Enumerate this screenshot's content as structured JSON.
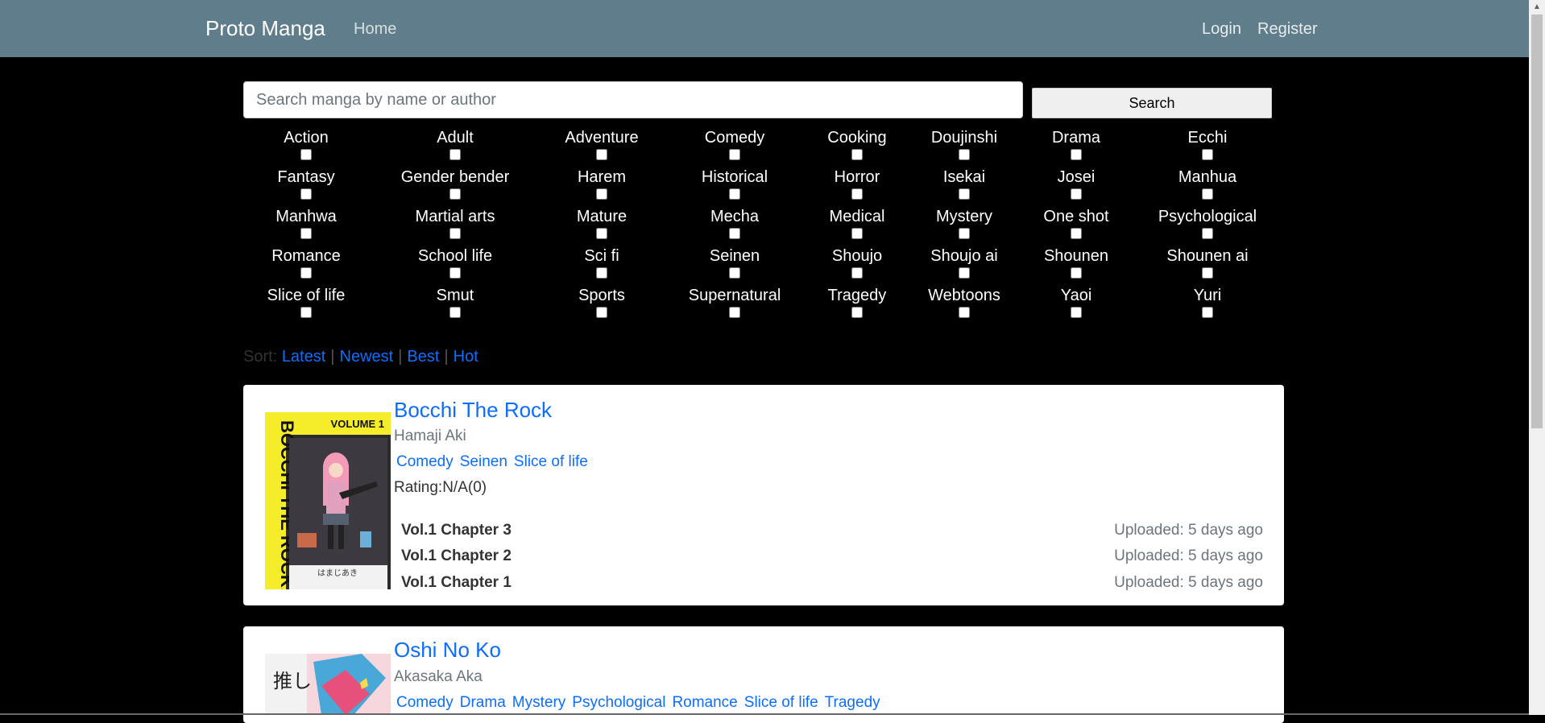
{
  "navbar": {
    "brand": "Proto Manga",
    "home": "Home",
    "login": "Login",
    "register": "Register",
    "background": "#607d8b"
  },
  "search": {
    "placeholder": "Search manga by name or author",
    "value": "",
    "button_label": "Search"
  },
  "genres": [
    [
      "Action",
      "Adult",
      "Adventure",
      "Comedy",
      "Cooking",
      "Doujinshi",
      "Drama",
      "Ecchi"
    ],
    [
      "Fantasy",
      "Gender bender",
      "Harem",
      "Historical",
      "Horror",
      "Isekai",
      "Josei",
      "Manhua"
    ],
    [
      "Manhwa",
      "Martial arts",
      "Mature",
      "Mecha",
      "Medical",
      "Mystery",
      "One shot",
      "Psychological"
    ],
    [
      "Romance",
      "School life",
      "Sci fi",
      "Seinen",
      "Shoujo",
      "Shoujo ai",
      "Shounen",
      "Shounen ai"
    ],
    [
      "Slice of life",
      "Smut",
      "Sports",
      "Supernatural",
      "Tragedy",
      "Webtoons",
      "Yaoi",
      "Yuri"
    ]
  ],
  "sort": {
    "label": "Sort:",
    "options": [
      "Latest",
      "Newest",
      "Best",
      "Hot"
    ],
    "separator": "|"
  },
  "manga": [
    {
      "title": "Bocchi The Rock",
      "author": "Hamaji Aki",
      "tags": [
        "Comedy",
        "Seinen",
        "Slice of life"
      ],
      "rating": "Rating:N/A(0)",
      "cover_text": "BOCCHI THE ROCK!",
      "cover_volume": "VOLUME 1",
      "cover_subtext": "はまじあき",
      "chapters": [
        {
          "name": "Vol.1 Chapter 3",
          "uploaded": "Uploaded: 5 days ago"
        },
        {
          "name": "Vol.1 Chapter 2",
          "uploaded": "Uploaded: 5 days ago"
        },
        {
          "name": "Vol.1 Chapter 1",
          "uploaded": "Uploaded: 5 days ago"
        }
      ]
    },
    {
      "title": "Oshi No Ko",
      "author": "Akasaka Aka",
      "tags": [
        "Comedy",
        "Drama",
        "Mystery",
        "Psychological",
        "Romance",
        "Slice of life",
        "Tragedy"
      ],
      "cover_text": "推し"
    }
  ],
  "colors": {
    "link": "#0d6efd",
    "page_background": "#000000"
  }
}
